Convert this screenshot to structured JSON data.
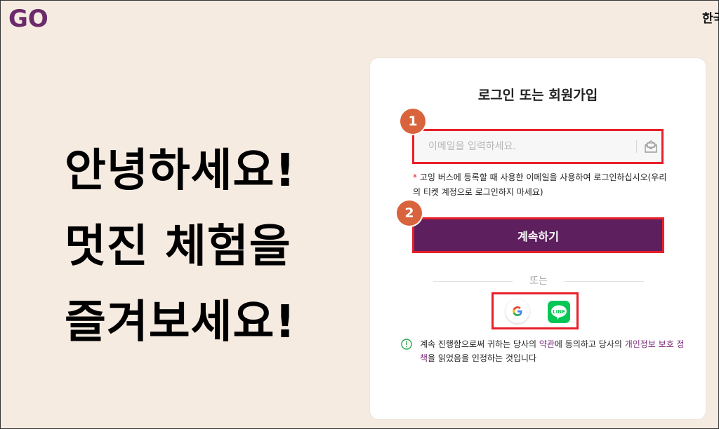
{
  "header": {
    "logo_text": "GO",
    "language": "한국어"
  },
  "hero": {
    "line1": "안녕하세요!",
    "line2": "멋진 체험을",
    "line3": "즐겨보세요!"
  },
  "card": {
    "title": "로그인 또는 회원가입",
    "step1": "1",
    "step2": "2",
    "email_placeholder": "이메일을 입력하세요.",
    "note_star": "*",
    "note_text": "고잉 버스에 등록할 때 사용한 이메일을 사용하여 로그인하십시오(우리의 티켓 계정으로 로그인하지 마세요)",
    "continue_label": "계속하기",
    "or_label": "또는",
    "terms": {
      "prefix": "계속 진행함으로써 귀하는 당사의 ",
      "terms_link": "약관",
      "middle": "에 동의하고 당사의 ",
      "privacy_link": "개인정보 보호 정책",
      "suffix": "을 읽었음을 인정하는 것입니다"
    }
  },
  "colors": {
    "brand_purple": "#5e1f5e",
    "highlight_red": "#e8202a",
    "step_orange": "#d9633c",
    "background": "#f5ebe1",
    "line_green": "#06c755"
  },
  "icons": [
    "go-logo",
    "mail-icon",
    "google-icon",
    "line-icon",
    "info-circle-icon"
  ]
}
